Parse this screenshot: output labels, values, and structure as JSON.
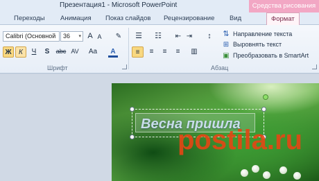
{
  "window": {
    "title": "Презентация1 - Microsoft PowerPoint"
  },
  "context_group": "Средства рисования",
  "tabs": [
    "Переходы",
    "Анимация",
    "Показ слайдов",
    "Рецензирование",
    "Вид",
    "Формат"
  ],
  "font": {
    "family": "Calibri (Основной",
    "size": "36",
    "grow": "A",
    "shrink": "A",
    "bold": "Ж",
    "italic": "К",
    "underline": "Ч",
    "shadow": "S",
    "strike": "abc",
    "spacing": "AV",
    "case": "Aa",
    "color": "A",
    "group_label": "Шрифт"
  },
  "paragraph": {
    "text_direction": "Направление текста",
    "align_text": "Выровнять текст",
    "smartart": "Преобразовать в SmartArt",
    "group_label": "Абзац"
  },
  "slide": {
    "text": "Весна пришла",
    "watermark": "postila.ru"
  },
  "colors": {
    "context_tab": "#f2a7c4",
    "selected_button": "#f8d880"
  }
}
